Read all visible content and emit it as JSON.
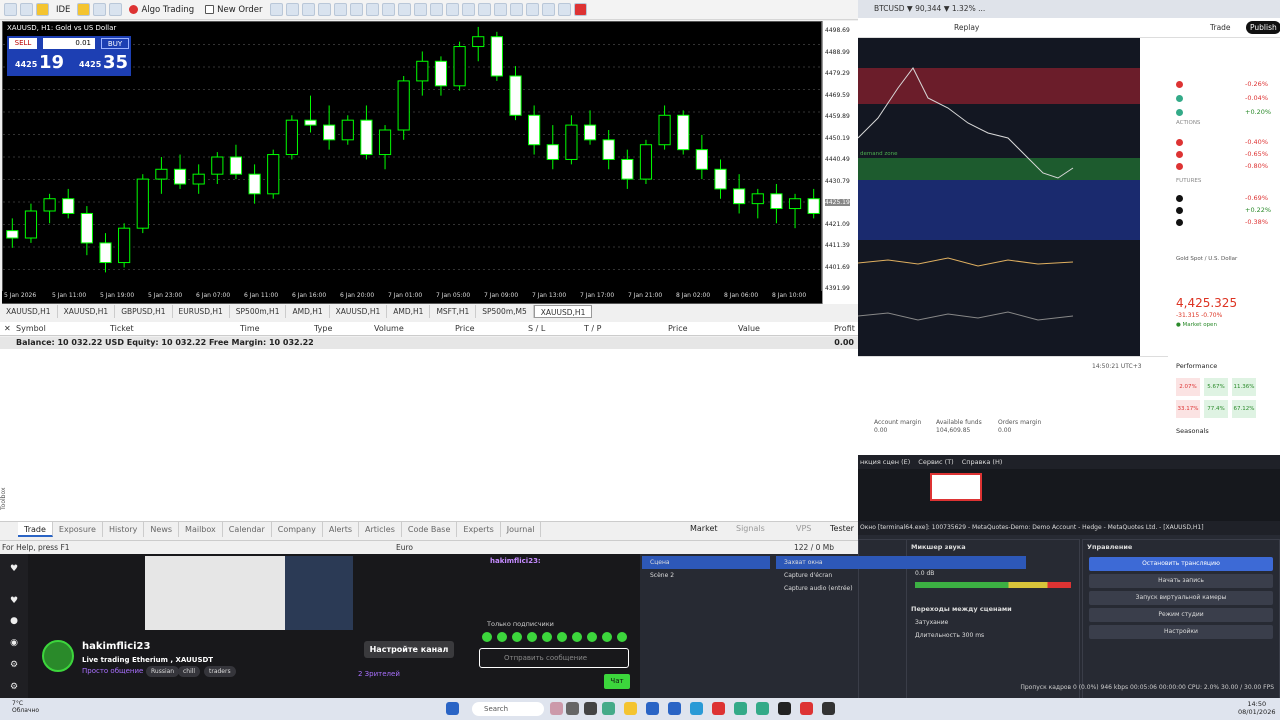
{
  "mt5": {
    "toolbar": {
      "ide": "IDE",
      "algo_trading": "Algo Trading",
      "new_order": "New Order"
    },
    "chart": {
      "title": "XAUUSD, H1:  Gold vs US Dollar",
      "sell_label": "SELL",
      "buy_label": "BUY",
      "lot": "0.01",
      "sell_price_small": "4425",
      "sell_price_big": "19",
      "buy_price_small": "4425",
      "buy_price_big": "35",
      "price_labels": [
        "4498.69",
        "4488.99",
        "4479.29",
        "4469.59",
        "4459.89",
        "4450.19",
        "4440.49",
        "4430.79",
        "4425.19",
        "4421.09",
        "4411.39",
        "4401.69",
        "4391.99"
      ],
      "time_labels": [
        "5 Jan 2026",
        "5 Jan 11:00",
        "5 Jan 19:00",
        "5 Jan 23:00",
        "6 Jan 07:00",
        "6 Jan 11:00",
        "6 Jan 16:00",
        "6 Jan 20:00",
        "7 Jan 01:00",
        "7 Jan 05:00",
        "7 Jan 09:00",
        "7 Jan 13:00",
        "7 Jan 17:00",
        "7 Jan 21:00",
        "8 Jan 02:00",
        "8 Jan 06:00",
        "8 Jan 10:00"
      ]
    },
    "symbol_tabs": [
      "XAUUSD,H1",
      "XAUUSD,H1",
      "GBPUSD,H1",
      "EURUSD,H1",
      "SP500m,H1",
      "AMD,H1",
      "XAUUSD,H1",
      "AMD,H1",
      "MSFT,H1",
      "SP500m,M5",
      "XAUUSD,H1"
    ],
    "toolbox_headers": [
      "Symbol",
      "Ticket",
      "Time",
      "Type",
      "Volume",
      "Price",
      "S / L",
      "T / P",
      "Price",
      "Value",
      "Profit"
    ],
    "balance_line": "Balance: 10 032.22 USD  Equity: 10 032.22  Free Margin: 10 032.22",
    "balance_profit": "0.00",
    "bottom_tabs": [
      "Trade",
      "Exposure",
      "History",
      "News",
      "Mailbox",
      "Calendar",
      "Company",
      "Alerts",
      "Articles",
      "Code Base",
      "Experts",
      "Journal"
    ],
    "market_label": "Market",
    "signals_label": "Signals",
    "vps_label": "VPS",
    "tester_label": "Tester",
    "status_help": "For Help, press F1",
    "status_currency": "Euro",
    "status_mem": "122 / 0 Mb",
    "toolbox_side": "Toolbox"
  },
  "tv": {
    "tab_title": "BTCUSD ▼ 90,344 ▼ 1.32% ...",
    "replay": "Replay",
    "trade": "Trade",
    "publish": "Publish",
    "demand_zone": "demand zone",
    "price": "4,425.325",
    "change": "-31.315  -0.70%",
    "market_open": "● Market open",
    "symbol_desc": "Gold Spot / U.S. Dollar",
    "performance": "Performance",
    "seasonals": "Seasonals",
    "watchlist_values": [
      "-0.26%",
      "-0.04%",
      "+0.20%",
      "-0.40%",
      "-0.65%",
      "-0.80%",
      "-0.69%",
      "+0.22%",
      "-0.38%"
    ],
    "watch_section1": "ACTIONS",
    "watch_section2": "FUTURES",
    "account_margin": "Account margin",
    "available_funds": "Available funds",
    "orders_margin": "Orders margin",
    "account_margin_val": "0.00",
    "available_funds_val": "104,609.85",
    "orders_margin_val": "0.00",
    "time_label": "14:50:21 UTC+3",
    "perf_values": [
      "2.07%",
      "5.67%",
      "11.36%",
      "33.17%",
      "77.4%",
      "67.12%"
    ]
  },
  "obs": {
    "menu": [
      "нкция сцен (E)",
      "Сервис (T)",
      "Справка (H)"
    ],
    "source_line": "Окно  [terminal64.exe]: 100735629 - MetaQuotes-Demo: Demo Account - Hedge - MetaQuotes Ltd. - [XAUUSD,H1]",
    "scenes_header": "Сцена",
    "scenes": [
      "Сцена",
      "Scène 2"
    ],
    "sources": [
      "Захват окна",
      "Capture d'écran",
      "Capture audio (entrée)"
    ],
    "mixer_title": "Микшер звука",
    "mixer_source": "Capture audio (entrée)",
    "mixer_db": "0.0 dB",
    "transitions_title": "Переходы между сценами",
    "transition": "Затухание",
    "duration_label": "Длительность",
    "duration": "300 ms",
    "controls_title": "Управление",
    "controls": [
      "Остановить трансляцию",
      "Начать запись",
      "Запуск виртуальной камеры",
      "Режим студии",
      "Настройки"
    ],
    "status": "Пропуск кадров 0 (0.0%)   946 kbps   00:05:06   00:00:00   CPU: 2.0%   30.00 / 30.00 FPS"
  },
  "twitch": {
    "channel": "hakimflici23",
    "title": "Live trading Etherium , XAUUSDT",
    "category": "Просто общение",
    "tags": [
      "Russian",
      "chill",
      "traders"
    ],
    "setup_btn": "Настройте канал",
    "viewers": "2 Зрителей",
    "chat_user": "hakimflici23:",
    "subs_only": "Только подписчики",
    "chat_placeholder": "Отправить сообщение",
    "chat_btn": "Чат"
  },
  "taskbar": {
    "search": "Search",
    "time": "14:50",
    "date": "08/01/2026",
    "weather_temp": "7°C",
    "weather_desc": "Облачно"
  },
  "colors": {
    "bull": "#00ff00",
    "bear": "#ffffff",
    "twitch_green": "#3cd63c",
    "obs_blue": "#3d6ad6"
  },
  "chart_data": {
    "type": "candlestick",
    "symbol": "XAUUSD",
    "timeframe": "H1",
    "ylim": [
      4390,
      4500
    ],
    "ohlc": [
      [
        4415,
        4420,
        4408,
        4412
      ],
      [
        4412,
        4426,
        4410,
        4423
      ],
      [
        4423,
        4430,
        4418,
        4428
      ],
      [
        4428,
        4432,
        4420,
        4422
      ],
      [
        4422,
        4425,
        4405,
        4410
      ],
      [
        4410,
        4414,
        4398,
        4402
      ],
      [
        4402,
        4418,
        4400,
        4416
      ],
      [
        4416,
        4438,
        4414,
        4436
      ],
      [
        4436,
        4445,
        4430,
        4440
      ],
      [
        4440,
        4446,
        4432,
        4434
      ],
      [
        4434,
        4442,
        4430,
        4438
      ],
      [
        4438,
        4447,
        4434,
        4445
      ],
      [
        4445,
        4450,
        4436,
        4438
      ],
      [
        4438,
        4442,
        4426,
        4430
      ],
      [
        4430,
        4448,
        4428,
        4446
      ],
      [
        4446,
        4462,
        4444,
        4460
      ],
      [
        4460,
        4470,
        4455,
        4458
      ],
      [
        4458,
        4466,
        4448,
        4452
      ],
      [
        4452,
        4462,
        4450,
        4460
      ],
      [
        4460,
        4466,
        4444,
        4446
      ],
      [
        4446,
        4458,
        4440,
        4456
      ],
      [
        4456,
        4478,
        4452,
        4476
      ],
      [
        4476,
        4488,
        4470,
        4484
      ],
      [
        4484,
        4486,
        4470,
        4474
      ],
      [
        4474,
        4492,
        4472,
        4490
      ],
      [
        4490,
        4498,
        4484,
        4494
      ],
      [
        4494,
        4496,
        4476,
        4478
      ],
      [
        4478,
        4482,
        4460,
        4462
      ],
      [
        4462,
        4466,
        4446,
        4450
      ],
      [
        4450,
        4458,
        4440,
        4444
      ],
      [
        4444,
        4462,
        4442,
        4458
      ],
      [
        4458,
        4464,
        4450,
        4452
      ],
      [
        4452,
        4456,
        4440,
        4444
      ],
      [
        4444,
        4448,
        4432,
        4436
      ],
      [
        4436,
        4452,
        4434,
        4450
      ],
      [
        4450,
        4466,
        4448,
        4462
      ],
      [
        4462,
        4464,
        4446,
        4448
      ],
      [
        4448,
        4454,
        4436,
        4440
      ],
      [
        4440,
        4444,
        4428,
        4432
      ],
      [
        4432,
        4438,
        4422,
        4426
      ],
      [
        4426,
        4432,
        4420,
        4430
      ],
      [
        4430,
        4434,
        4418,
        4424
      ],
      [
        4424,
        4430,
        4416,
        4428
      ],
      [
        4428,
        4432,
        4420,
        4422
      ]
    ]
  }
}
